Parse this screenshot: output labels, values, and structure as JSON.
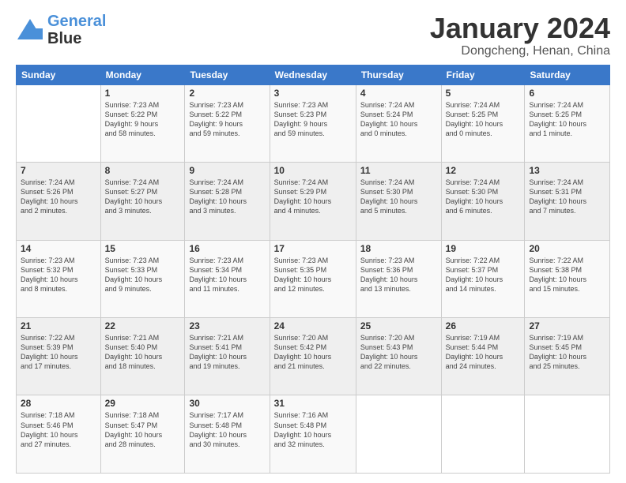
{
  "logo": {
    "line1": "General",
    "line2": "Blue"
  },
  "title": "January 2024",
  "subtitle": "Dongcheng, Henan, China",
  "days": [
    "Sunday",
    "Monday",
    "Tuesday",
    "Wednesday",
    "Thursday",
    "Friday",
    "Saturday"
  ],
  "weeks": [
    [
      {
        "day": "",
        "content": ""
      },
      {
        "day": "1",
        "content": "Sunrise: 7:23 AM\nSunset: 5:22 PM\nDaylight: 9 hours\nand 58 minutes."
      },
      {
        "day": "2",
        "content": "Sunrise: 7:23 AM\nSunset: 5:22 PM\nDaylight: 9 hours\nand 59 minutes."
      },
      {
        "day": "3",
        "content": "Sunrise: 7:23 AM\nSunset: 5:23 PM\nDaylight: 9 hours\nand 59 minutes."
      },
      {
        "day": "4",
        "content": "Sunrise: 7:24 AM\nSunset: 5:24 PM\nDaylight: 10 hours\nand 0 minutes."
      },
      {
        "day": "5",
        "content": "Sunrise: 7:24 AM\nSunset: 5:25 PM\nDaylight: 10 hours\nand 0 minutes."
      },
      {
        "day": "6",
        "content": "Sunrise: 7:24 AM\nSunset: 5:25 PM\nDaylight: 10 hours\nand 1 minute."
      }
    ],
    [
      {
        "day": "7",
        "content": "Sunrise: 7:24 AM\nSunset: 5:26 PM\nDaylight: 10 hours\nand 2 minutes."
      },
      {
        "day": "8",
        "content": "Sunrise: 7:24 AM\nSunset: 5:27 PM\nDaylight: 10 hours\nand 3 minutes."
      },
      {
        "day": "9",
        "content": "Sunrise: 7:24 AM\nSunset: 5:28 PM\nDaylight: 10 hours\nand 3 minutes."
      },
      {
        "day": "10",
        "content": "Sunrise: 7:24 AM\nSunset: 5:29 PM\nDaylight: 10 hours\nand 4 minutes."
      },
      {
        "day": "11",
        "content": "Sunrise: 7:24 AM\nSunset: 5:30 PM\nDaylight: 10 hours\nand 5 minutes."
      },
      {
        "day": "12",
        "content": "Sunrise: 7:24 AM\nSunset: 5:30 PM\nDaylight: 10 hours\nand 6 minutes."
      },
      {
        "day": "13",
        "content": "Sunrise: 7:24 AM\nSunset: 5:31 PM\nDaylight: 10 hours\nand 7 minutes."
      }
    ],
    [
      {
        "day": "14",
        "content": "Sunrise: 7:23 AM\nSunset: 5:32 PM\nDaylight: 10 hours\nand 8 minutes."
      },
      {
        "day": "15",
        "content": "Sunrise: 7:23 AM\nSunset: 5:33 PM\nDaylight: 10 hours\nand 9 minutes."
      },
      {
        "day": "16",
        "content": "Sunrise: 7:23 AM\nSunset: 5:34 PM\nDaylight: 10 hours\nand 11 minutes."
      },
      {
        "day": "17",
        "content": "Sunrise: 7:23 AM\nSunset: 5:35 PM\nDaylight: 10 hours\nand 12 minutes."
      },
      {
        "day": "18",
        "content": "Sunrise: 7:23 AM\nSunset: 5:36 PM\nDaylight: 10 hours\nand 13 minutes."
      },
      {
        "day": "19",
        "content": "Sunrise: 7:22 AM\nSunset: 5:37 PM\nDaylight: 10 hours\nand 14 minutes."
      },
      {
        "day": "20",
        "content": "Sunrise: 7:22 AM\nSunset: 5:38 PM\nDaylight: 10 hours\nand 15 minutes."
      }
    ],
    [
      {
        "day": "21",
        "content": "Sunrise: 7:22 AM\nSunset: 5:39 PM\nDaylight: 10 hours\nand 17 minutes."
      },
      {
        "day": "22",
        "content": "Sunrise: 7:21 AM\nSunset: 5:40 PM\nDaylight: 10 hours\nand 18 minutes."
      },
      {
        "day": "23",
        "content": "Sunrise: 7:21 AM\nSunset: 5:41 PM\nDaylight: 10 hours\nand 19 minutes."
      },
      {
        "day": "24",
        "content": "Sunrise: 7:20 AM\nSunset: 5:42 PM\nDaylight: 10 hours\nand 21 minutes."
      },
      {
        "day": "25",
        "content": "Sunrise: 7:20 AM\nSunset: 5:43 PM\nDaylight: 10 hours\nand 22 minutes."
      },
      {
        "day": "26",
        "content": "Sunrise: 7:19 AM\nSunset: 5:44 PM\nDaylight: 10 hours\nand 24 minutes."
      },
      {
        "day": "27",
        "content": "Sunrise: 7:19 AM\nSunset: 5:45 PM\nDaylight: 10 hours\nand 25 minutes."
      }
    ],
    [
      {
        "day": "28",
        "content": "Sunrise: 7:18 AM\nSunset: 5:46 PM\nDaylight: 10 hours\nand 27 minutes."
      },
      {
        "day": "29",
        "content": "Sunrise: 7:18 AM\nSunset: 5:47 PM\nDaylight: 10 hours\nand 28 minutes."
      },
      {
        "day": "30",
        "content": "Sunrise: 7:17 AM\nSunset: 5:48 PM\nDaylight: 10 hours\nand 30 minutes."
      },
      {
        "day": "31",
        "content": "Sunrise: 7:16 AM\nSunset: 5:48 PM\nDaylight: 10 hours\nand 32 minutes."
      },
      {
        "day": "",
        "content": ""
      },
      {
        "day": "",
        "content": ""
      },
      {
        "day": "",
        "content": ""
      }
    ]
  ]
}
